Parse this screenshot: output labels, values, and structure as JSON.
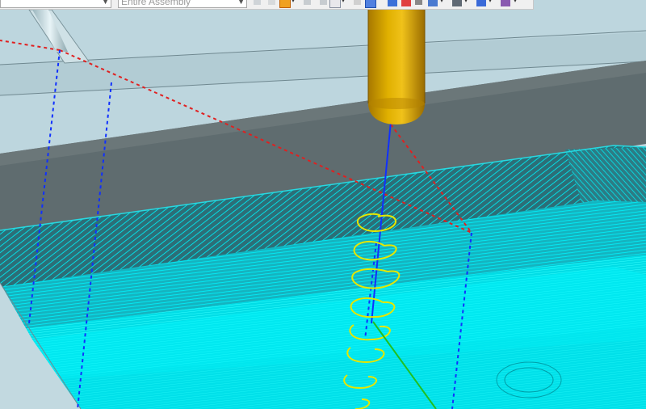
{
  "toolbar": {
    "filter_combo_value": "",
    "assembly_combo_value": "Entire Assembly",
    "icons": [
      "undo-icon",
      "redo-icon",
      "paste-icon",
      "separator",
      "tool-icon",
      "view-icon",
      "shaded-icon",
      "component-icon",
      "sphere-icon",
      "cube-icon",
      "generate-path-icon",
      "refresh-icon",
      "filter-icon",
      "layer-icon",
      "display-icon",
      "measure-icon"
    ]
  },
  "viewport": {
    "tool_color": "#d4a400",
    "toolpath_color": "#00e5ee",
    "helix_color": "#e6e600",
    "rapid_color": "#e02020",
    "plunge_color": "#1030ff",
    "feed_color": "#20c020"
  }
}
